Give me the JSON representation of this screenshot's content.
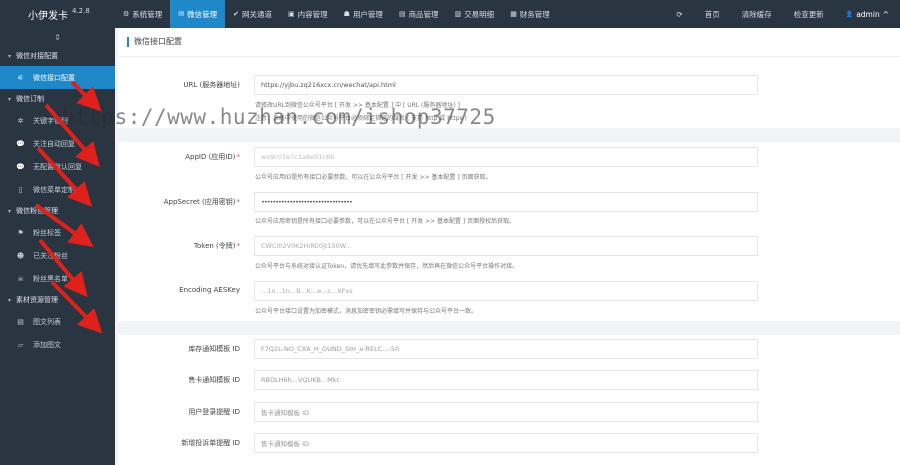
{
  "brand": {
    "name": "小伊发卡",
    "version": "4.2.8"
  },
  "nav": [
    {
      "label": "系统管理",
      "icon": "gear-icon",
      "glyph": "⚙"
    },
    {
      "label": "微信管理",
      "icon": "wechat-icon",
      "glyph": "✉"
    },
    {
      "label": "网关通道",
      "icon": "gateway-icon",
      "glyph": "✔"
    },
    {
      "label": "内容管理",
      "icon": "content-icon",
      "glyph": "▣"
    },
    {
      "label": "用户管理",
      "icon": "users-icon",
      "glyph": "☗"
    },
    {
      "label": "商品管理",
      "icon": "goods-icon",
      "glyph": "▤"
    },
    {
      "label": "交易明细",
      "icon": "trade-icon",
      "glyph": "▥"
    },
    {
      "label": "财务管理",
      "icon": "finance-icon",
      "glyph": "▦"
    }
  ],
  "nav_right": {
    "refresh_glyph": "⟳",
    "home": "首页",
    "clear_cache": "清除缓存",
    "check_update": "检查更新",
    "user": "admin",
    "user_glyph": "👤",
    "caret": "^"
  },
  "sidebar": {
    "toggle_glyph": "⇕",
    "groups": [
      {
        "label": "微信对接配置",
        "items": [
          {
            "label": "微信接口配置",
            "glyph": "⚟",
            "active": true
          }
        ]
      },
      {
        "label": "微信订制",
        "items": [
          {
            "label": "关键字管理",
            "glyph": "✲"
          },
          {
            "label": "关注自动回复",
            "glyph": "💬"
          },
          {
            "label": "无配置默认回复",
            "glyph": "💬"
          },
          {
            "label": "微信菜单定制",
            "glyph": "▯"
          }
        ]
      },
      {
        "label": "微信粉丝管理",
        "items": [
          {
            "label": "粉丝标签",
            "glyph": "⚑"
          },
          {
            "label": "已关注粉丝",
            "glyph": "☻"
          },
          {
            "label": "粉丝黑名单",
            "glyph": "☠"
          }
        ]
      },
      {
        "label": "素材资源管理",
        "items": [
          {
            "label": "图文列表",
            "glyph": "▤"
          },
          {
            "label": "添加图文",
            "glyph": "▱"
          }
        ]
      }
    ]
  },
  "panel": {
    "title": "微信接口配置"
  },
  "form": {
    "url": {
      "label": "URL (服务器地址)",
      "value": "https://yjbu.zq216xcx.cn/wechat/api.html",
      "help1": "请修改URL到微信公众号平台 [ 开发 >> 基本配置 ] 中 [ URL (服务器地址) ]",
      "help2": "注意：系统中使用的微信公众号平台必须绑定指定的域名 ( 支持 http 或 https )"
    },
    "appid": {
      "label": "AppID (应用ID)",
      "required": "*",
      "value": "wx9c01e7c1a8e01c6b",
      "help": "公众号应用ID是所有接口必要参数，可以在公众号平台 [ 开发 >> 基本配置 ] 页面获取。"
    },
    "appsecret": {
      "label": "AppSecret (应用密钥)",
      "required": "*",
      "value": "••••••••••••••••••••••••••••••••",
      "help": "公众号应用密钥是所有接口必要参数，可以在公众号平台 [ 开发 >> 基本配置 ] 页面授权后获取。"
    },
    "token": {
      "label": "Token (令牌)",
      "required": "*",
      "value": "CWCi02V0K2HiRE0jt1S0W...",
      "help": "公众号平台与系统对接认证Token，请优先填写此参数并保存，然后再在微信公众号平台操作对接。"
    },
    "aeskey": {
      "label": "Encoding AESKey",
      "value": "...1n...1n...B...K...e...c...XFxs",
      "help": "公众号平台接口设置为加密模式，消息加密密钥必需填写并保持与公众号平台一致。"
    },
    "tpl_stock": {
      "label": "库存通知模板 ID",
      "value": "F7Q2L-NO_CXA_H_OUND_SIH_e-RELC...-50"
    },
    "tpl_deliver": {
      "label": "售卡通知模板 ID",
      "value": "RBDLH6h...VQUKB...Mkc"
    },
    "tpl_login": {
      "label": "用户登录提醒 ID",
      "placeholder": "售卡通知模板 ID"
    },
    "tpl_complaint": {
      "label": "新增投诉单提醒 ID",
      "placeholder": "售卡通知模板 ID"
    }
  },
  "watermark": "https://www.huzhan.com/ishop37725",
  "colors": {
    "nav_bg": "#2a3542",
    "accent": "#1e88c8",
    "arrow": "#e0201b",
    "required": "#e74c3c"
  }
}
